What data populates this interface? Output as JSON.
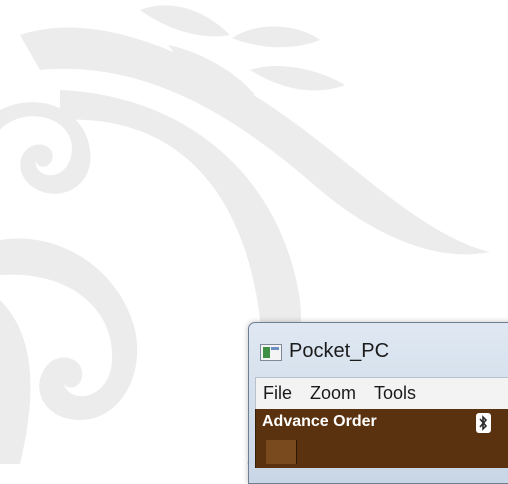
{
  "window": {
    "title": "Pocket_PC"
  },
  "menubar": {
    "items": [
      {
        "label": "File"
      },
      {
        "label": "Zoom"
      },
      {
        "label": "Tools"
      }
    ]
  },
  "device": {
    "header_title": "Advance Order",
    "header_icon": "bluetooth-icon"
  },
  "colors": {
    "background": "#ffffff",
    "swirl": "#ececec",
    "header_bar": "#5a3210",
    "menubar": "#f3f3f3"
  },
  "decoration": {
    "icon": "leaf-swirl-watermark"
  }
}
